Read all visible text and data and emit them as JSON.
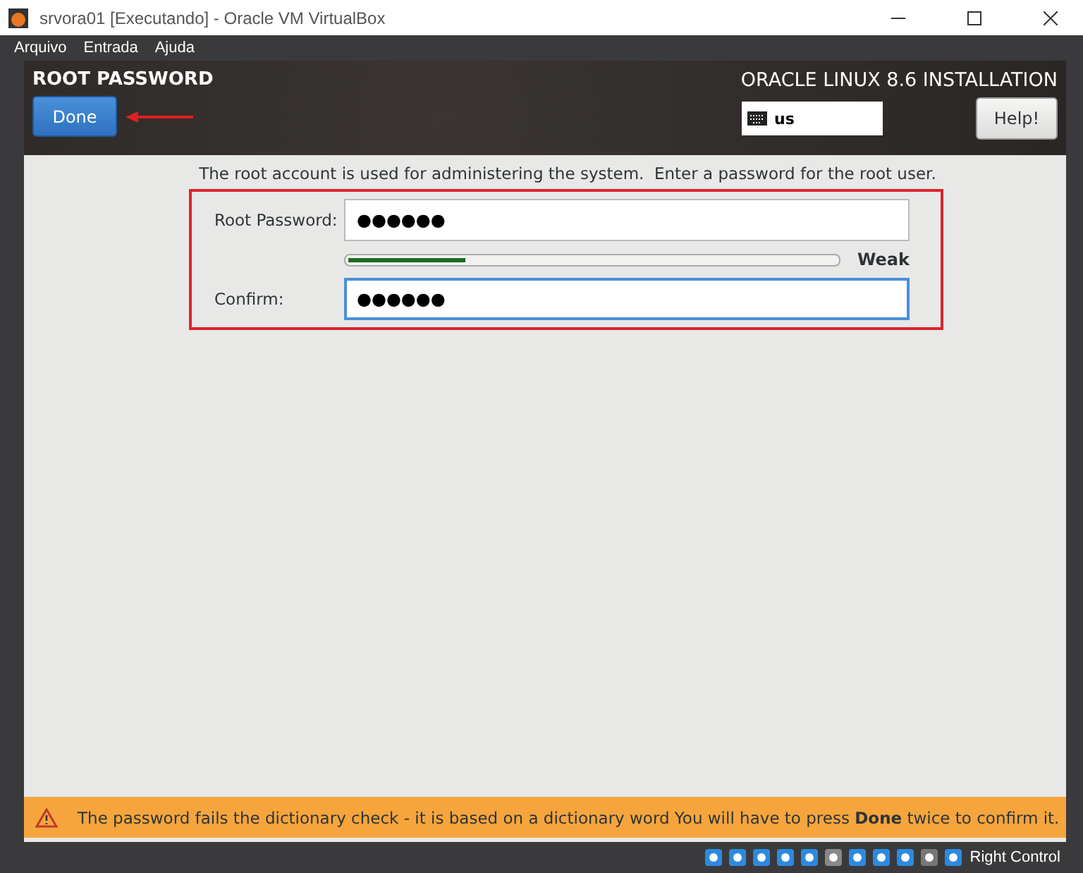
{
  "window": {
    "title": "srvora01 [Executando] - Oracle VM VirtualBox"
  },
  "menu": [
    "Arquivo",
    "Entrada",
    "Ajuda"
  ],
  "header": {
    "title": "ROOT PASSWORD",
    "done_button": "Done",
    "product": "ORACLE LINUX 8.6 INSTALLATION",
    "keyboard_layout": "us",
    "help_button": "Help!"
  },
  "intro": "The root account is used for administering the system.  Enter a password for the root user.",
  "fields": [
    {
      "label": "Root Password:",
      "value": "●●●●●●",
      "focused": false
    },
    {
      "label": "Confirm:",
      "value": "●●●●●●",
      "focused": true
    }
  ],
  "strength": {
    "level": 0.25,
    "reading": "Weak"
  },
  "warning": "The password fails the dictionary check - it is based on a dictionary word You will have to press **Done** twice to confirm it.",
  "status_bar": {
    "host_key": "Right Control"
  }
}
